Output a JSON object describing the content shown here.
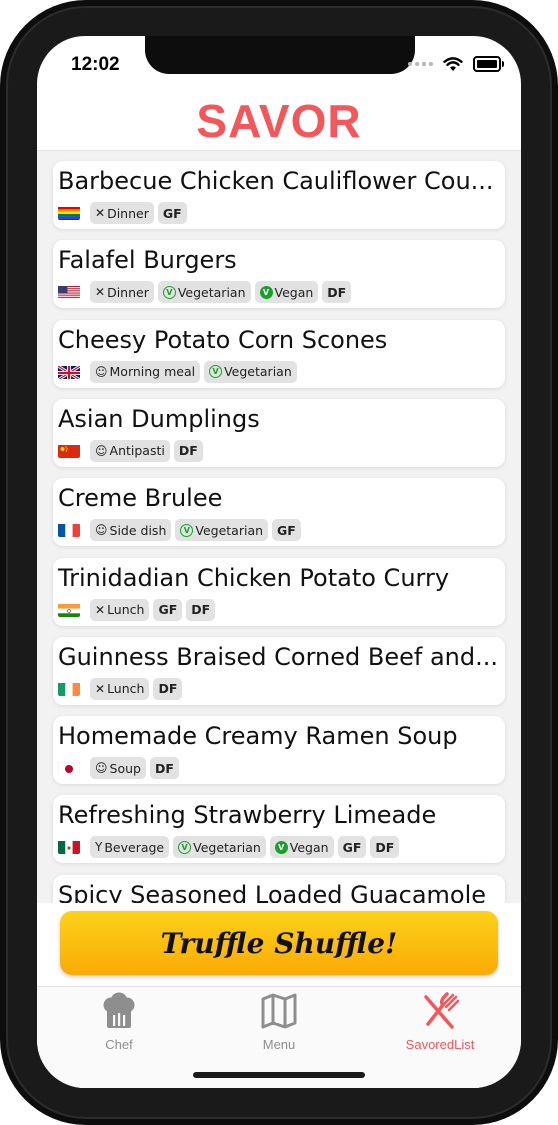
{
  "status_bar": {
    "time": "12:02"
  },
  "header": {
    "title": "SAVOR"
  },
  "recipes": [
    {
      "title": "Barbecue Chicken Cauliflower Cou...",
      "flag": "rainbow",
      "tags": [
        {
          "icon": "utensils-icon",
          "label": "Dinner"
        },
        {
          "label": "GF",
          "bold": true
        }
      ]
    },
    {
      "title": "Falafel Burgers",
      "flag": "usa",
      "tags": [
        {
          "icon": "utensils-icon",
          "label": "Dinner"
        },
        {
          "icon": "vegetarian-icon",
          "label": "Vegetarian"
        },
        {
          "icon": "vegan-icon",
          "label": "Vegan"
        },
        {
          "label": "DF",
          "bold": true
        }
      ]
    },
    {
      "title": "Cheesy Potato Corn Scones",
      "flag": "uk",
      "tags": [
        {
          "icon": "smiley-icon",
          "label": "Morning meal"
        },
        {
          "icon": "vegetarian-icon",
          "label": "Vegetarian"
        }
      ]
    },
    {
      "title": "Asian Dumplings",
      "flag": "china",
      "tags": [
        {
          "icon": "smiley-icon",
          "label": "Antipasti"
        },
        {
          "label": "DF",
          "bold": true
        }
      ]
    },
    {
      "title": "Creme Brulee",
      "flag": "france",
      "tags": [
        {
          "icon": "smiley-icon",
          "label": "Side dish"
        },
        {
          "icon": "vegetarian-icon",
          "label": "Vegetarian"
        },
        {
          "label": "GF",
          "bold": true
        }
      ]
    },
    {
      "title": "Trinidadian Chicken Potato Curry",
      "flag": "india",
      "tags": [
        {
          "icon": "utensils-icon",
          "label": "Lunch"
        },
        {
          "label": "GF",
          "bold": true
        },
        {
          "label": "DF",
          "bold": true
        }
      ]
    },
    {
      "title": "Guinness Braised Corned Beef and...",
      "flag": "ireland",
      "tags": [
        {
          "icon": "utensils-icon",
          "label": "Lunch"
        },
        {
          "label": "DF",
          "bold": true
        }
      ]
    },
    {
      "title": "Homemade Creamy Ramen Soup",
      "flag": "japan",
      "tags": [
        {
          "icon": "smiley-icon",
          "label": "Soup"
        },
        {
          "label": "DF",
          "bold": true
        }
      ]
    },
    {
      "title": "Refreshing Strawberry Limeade",
      "flag": "mexico",
      "tags": [
        {
          "icon": "cocktail-icon",
          "label": "Beverage"
        },
        {
          "icon": "vegetarian-icon",
          "label": "Vegetarian"
        },
        {
          "icon": "vegan-icon",
          "label": "Vegan"
        },
        {
          "label": "GF",
          "bold": true
        },
        {
          "label": "DF",
          "bold": true
        }
      ]
    },
    {
      "title": "Spicy Seasoned Loaded Guacamole",
      "flag": "",
      "tags": []
    }
  ],
  "shuffle_button": {
    "label": "Truffle Shuffle!"
  },
  "tab_bar": {
    "items": [
      {
        "label": "Chef",
        "icon": "chef-hat-icon",
        "active": false
      },
      {
        "label": "Menu",
        "icon": "map-icon",
        "active": false
      },
      {
        "label": "SavoredList",
        "icon": "fork-knife-icon",
        "active": true
      }
    ]
  },
  "colors": {
    "accent": "#f5565a",
    "button_top": "#fbd21a",
    "button_bottom": "#fbaa06",
    "tab_inactive": "#8e8e8e",
    "veg_green": "#17a12a"
  }
}
